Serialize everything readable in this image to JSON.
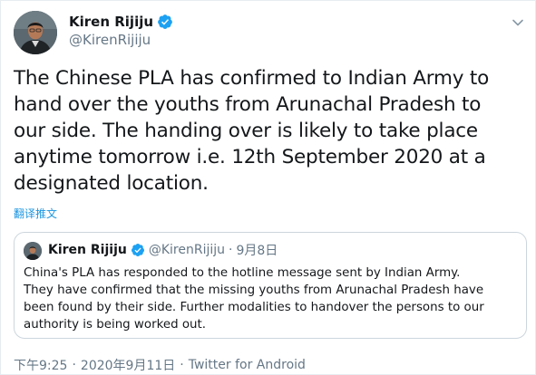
{
  "author": {
    "display_name": "Kiren Rijiju",
    "handle": "@KirenRijiju",
    "avatar_icon": "profile-photo",
    "verified_icon": "verified-badge-icon",
    "verified_color": "#1da1f2"
  },
  "tweet": {
    "text": "The Chinese PLA has confirmed to Indian Army to\nhand over the youths from Arunachal Pradesh to\nour side. The handing over is likely to take place\nanytime tomorrow i.e. 12th September 2020 at a\ndesignated location.",
    "translate_label": "翻译推文"
  },
  "quoted_tweet": {
    "display_name": "Kiren Rijiju",
    "handle": "@KirenRijiju",
    "separator": "·",
    "date": "9月8日",
    "text": "China's PLA has responded to the hotline message sent by Indian Army.\nThey have confirmed that the missing youths from Arunachal Pradesh have\nbeen found by their side. Further modalities to handover the persons to our\nauthority is being worked out."
  },
  "footer": {
    "time": "下午9:25",
    "separator": "·",
    "date": "2020年9月11日",
    "source": "Twitter for Android"
  },
  "colors": {
    "text": "#14171a",
    "secondary": "#657786",
    "link": "#1b95e0",
    "border": "#ccd6dd"
  }
}
